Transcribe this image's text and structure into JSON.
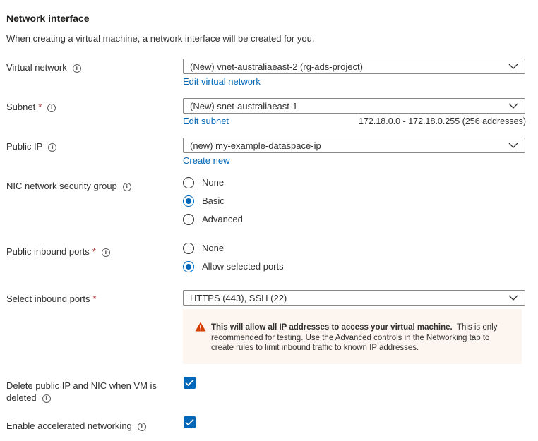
{
  "section": {
    "title": "Network interface",
    "description": "When creating a virtual machine, a network interface will be created for you."
  },
  "virtual_network": {
    "label": "Virtual network",
    "value": "(New) vnet-australiaeast-2 (rg-ads-project)",
    "link": "Edit virtual network"
  },
  "subnet": {
    "label": "Subnet",
    "required": "*",
    "value": "(New) snet-australiaeast-1",
    "link": "Edit subnet",
    "range": "172.18.0.0 - 172.18.0.255 (256 addresses)"
  },
  "public_ip": {
    "label": "Public IP",
    "value": "(new) my-example-dataspace-ip",
    "link": "Create new"
  },
  "nic_nsg": {
    "label": "NIC network security group",
    "options": [
      "None",
      "Basic",
      "Advanced"
    ],
    "selected": "Basic"
  },
  "public_inbound_ports": {
    "label": "Public inbound ports",
    "required": "*",
    "options": [
      "None",
      "Allow selected ports"
    ],
    "selected": "Allow selected ports"
  },
  "select_inbound_ports": {
    "label": "Select inbound ports",
    "required": "*",
    "value": "HTTPS (443), SSH (22)"
  },
  "warning": {
    "bold": "This will allow all IP addresses to access your virtual machine.",
    "text": "This is only recommended for testing.  Use the Advanced controls in the Networking tab to create rules to limit inbound traffic to known IP addresses."
  },
  "delete_public_ip": {
    "label_line1": "Delete public IP and NIC when VM is",
    "label_line2": "deleted",
    "checked": true
  },
  "accelerated_networking": {
    "label": "Enable accelerated networking",
    "checked": true
  },
  "colors": {
    "accent": "#0067b8",
    "required": "#a4262c",
    "warning_bg": "#fdf6f0",
    "warning_icon": "#d83b01"
  },
  "icons": {
    "info": "info-icon",
    "chevron": "chevron-down-icon",
    "warning": "warning-icon",
    "check": "checkmark-icon"
  }
}
